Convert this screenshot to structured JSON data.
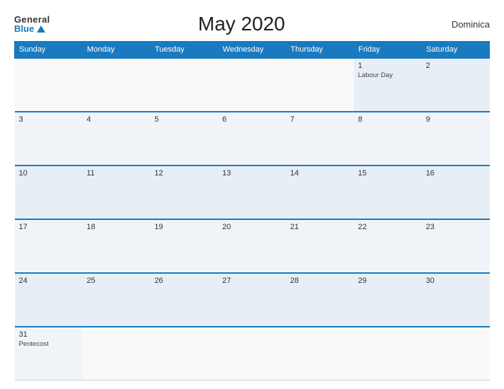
{
  "logo": {
    "general": "General",
    "blue": "Blue"
  },
  "header": {
    "title": "May 2020",
    "country": "Dominica"
  },
  "weekdays": [
    "Sunday",
    "Monday",
    "Tuesday",
    "Wednesday",
    "Thursday",
    "Friday",
    "Saturday"
  ],
  "weeks": [
    [
      {
        "day": "",
        "event": ""
      },
      {
        "day": "",
        "event": ""
      },
      {
        "day": "",
        "event": ""
      },
      {
        "day": "",
        "event": ""
      },
      {
        "day": "",
        "event": ""
      },
      {
        "day": "1",
        "event": "Labour Day"
      },
      {
        "day": "2",
        "event": ""
      }
    ],
    [
      {
        "day": "3",
        "event": ""
      },
      {
        "day": "4",
        "event": ""
      },
      {
        "day": "5",
        "event": ""
      },
      {
        "day": "6",
        "event": ""
      },
      {
        "day": "7",
        "event": ""
      },
      {
        "day": "8",
        "event": ""
      },
      {
        "day": "9",
        "event": ""
      }
    ],
    [
      {
        "day": "10",
        "event": ""
      },
      {
        "day": "11",
        "event": ""
      },
      {
        "day": "12",
        "event": ""
      },
      {
        "day": "13",
        "event": ""
      },
      {
        "day": "14",
        "event": ""
      },
      {
        "day": "15",
        "event": ""
      },
      {
        "day": "16",
        "event": ""
      }
    ],
    [
      {
        "day": "17",
        "event": ""
      },
      {
        "day": "18",
        "event": ""
      },
      {
        "day": "19",
        "event": ""
      },
      {
        "day": "20",
        "event": ""
      },
      {
        "day": "21",
        "event": ""
      },
      {
        "day": "22",
        "event": ""
      },
      {
        "day": "23",
        "event": ""
      }
    ],
    [
      {
        "day": "24",
        "event": ""
      },
      {
        "day": "25",
        "event": ""
      },
      {
        "day": "26",
        "event": ""
      },
      {
        "day": "27",
        "event": ""
      },
      {
        "day": "28",
        "event": ""
      },
      {
        "day": "29",
        "event": ""
      },
      {
        "day": "30",
        "event": ""
      }
    ],
    [
      {
        "day": "31",
        "event": "Pentecost"
      },
      {
        "day": "",
        "event": ""
      },
      {
        "day": "",
        "event": ""
      },
      {
        "day": "",
        "event": ""
      },
      {
        "day": "",
        "event": ""
      },
      {
        "day": "",
        "event": ""
      },
      {
        "day": "",
        "event": ""
      }
    ]
  ]
}
